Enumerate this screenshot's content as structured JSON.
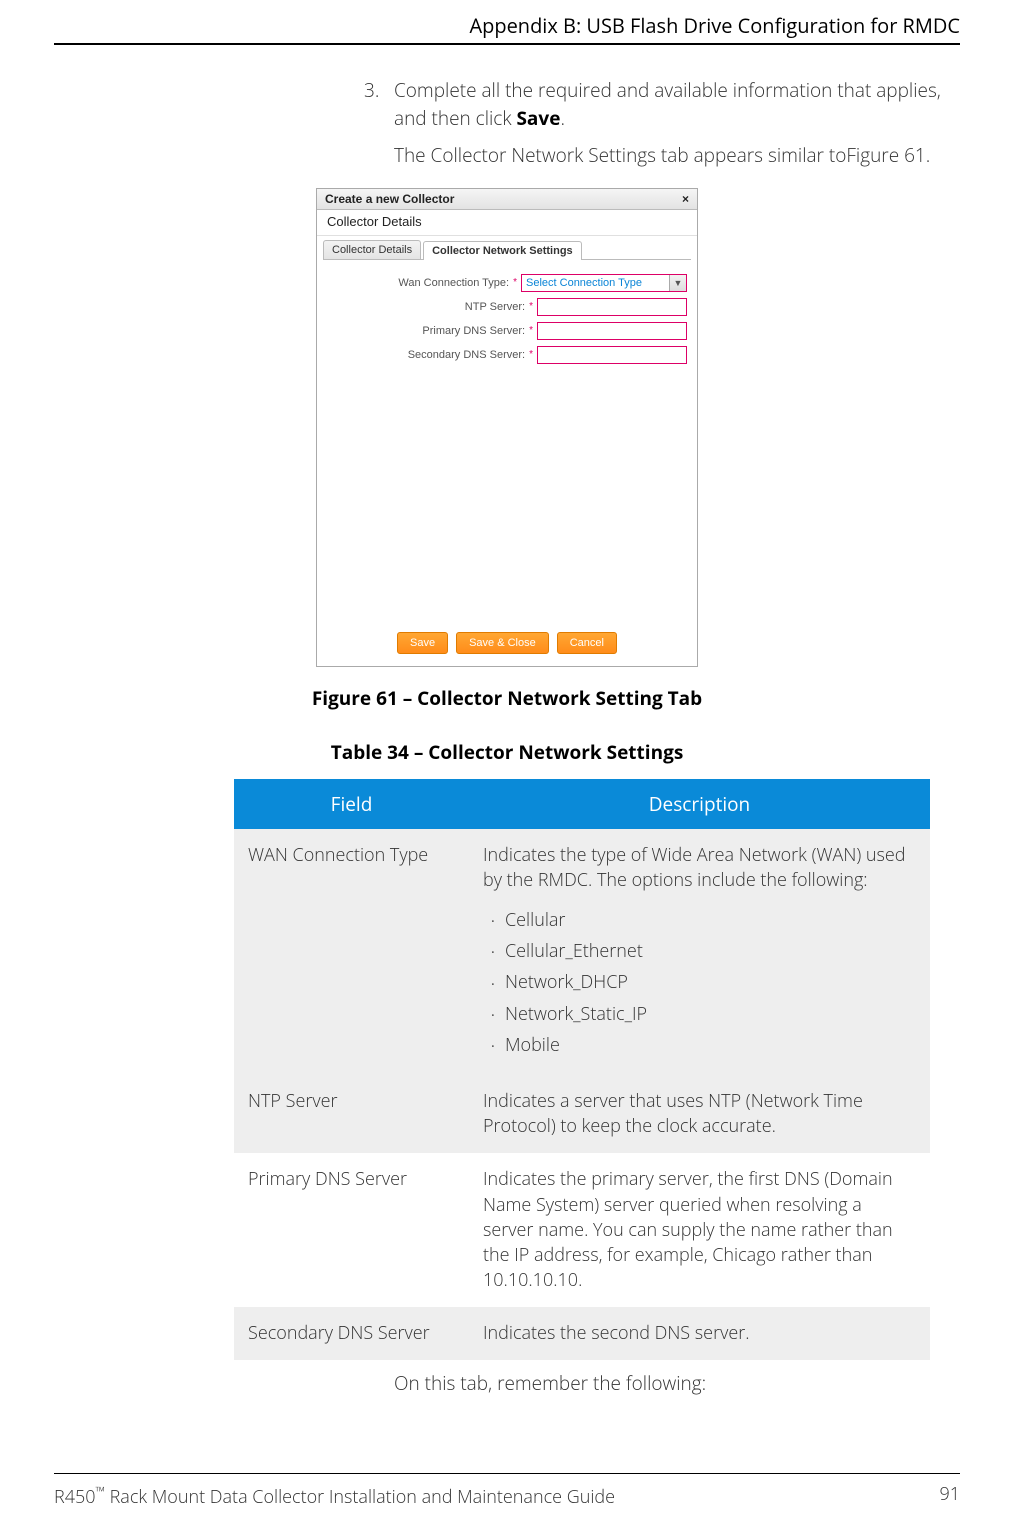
{
  "header": {
    "running": "Appendix B: USB Flash Drive Configuration for RMDC"
  },
  "step": {
    "number": "3.",
    "text_a": "Complete all the required and available information that applies, and then click ",
    "bold": "Save",
    "text_b": ".",
    "follow": "The Collector Network Settings tab appears similar toFigure 61."
  },
  "dialog": {
    "title": "Create a new Collector",
    "close": "×",
    "subhead": "Collector Details",
    "tabs": {
      "a": "Collector Details",
      "b": "Collector Network Settings"
    },
    "fields": {
      "wan_label": "Wan Connection Type:",
      "wan_placeholder": "Select Connection Type",
      "ntp_label": "NTP Server:",
      "pdns_label": "Primary DNS Server:",
      "sdns_label": "Secondary DNS Server:"
    },
    "buttons": {
      "save": "Save",
      "save_close": "Save & Close",
      "cancel": "Cancel"
    }
  },
  "figure_caption": "Figure 61  –  Collector Network Setting Tab",
  "table_caption": "Table 34  –  Collector Network Settings",
  "table": {
    "head_field": "Field",
    "head_desc": "Description",
    "r1_field": "WAN Connection Type",
    "r1_desc": "Indicates the type of Wide Area Network (WAN) used by the RMDC. The options include the following:",
    "r1_items": [
      "Cellular",
      "Cellular_Ethernet",
      "Network_DHCP",
      "Network_Static_IP",
      "Mobile"
    ],
    "r2_field": "NTP Server",
    "r2_desc": "Indicates a server that uses NTP (Network Time Protocol) to keep the clock accurate.",
    "r3_field": "Primary DNS Server",
    "r3_desc": "Indicates the primary server, the first DNS (Domain Name System) server queried when resolving a server name. You can supply the name rather than the IP address, for example, Chicago rather than 10.10.10.10.",
    "r4_field": "Secondary DNS Server",
    "r4_desc": "Indicates the second DNS server."
  },
  "closing": "On this tab, remember the following:",
  "footer": {
    "left_a": "R450",
    "tm": "™",
    "left_b": " Rack Mount Data Collector Installation and Maintenance Guide",
    "page": "91"
  }
}
